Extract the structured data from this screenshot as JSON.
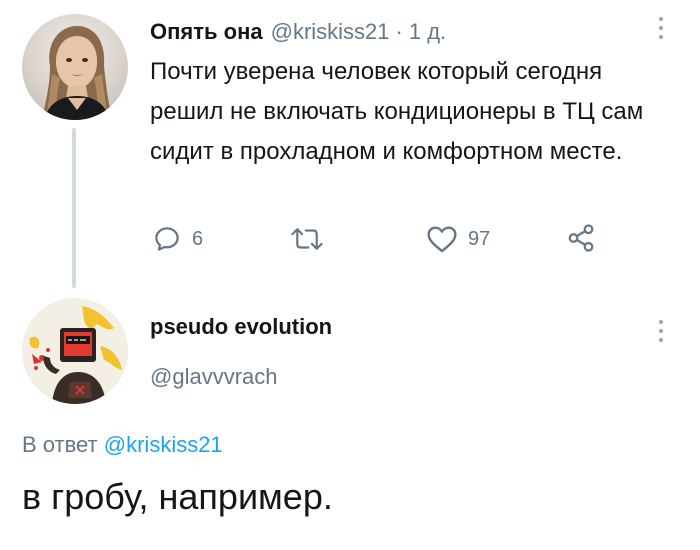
{
  "tweet": {
    "author_name": "Опять она",
    "author_handle": "@kriskiss21",
    "separator": "·",
    "time": "1 д.",
    "text": "Почти уверена человек который сегодня решил не включать кондиционеры в ТЦ сам сидит в прохладном и комфортном месте.",
    "actions": {
      "reply": {
        "icon": "reply-icon",
        "count": "6"
      },
      "retweet": {
        "icon": "retweet-icon",
        "count": ""
      },
      "like": {
        "icon": "heart-icon",
        "count": "97"
      },
      "share": {
        "icon": "share-icon"
      }
    }
  },
  "reply": {
    "author_name": "pseudo evolution",
    "author_handle": "@glavvvrach",
    "reply_to_prefix": "В ответ",
    "reply_to_handle": "@kriskiss21",
    "text": "в гробу, например."
  },
  "colors": {
    "text": "#14171a",
    "secondary": "#657786",
    "link": "#1da1f2",
    "thread_line": "#d3dbe2"
  }
}
